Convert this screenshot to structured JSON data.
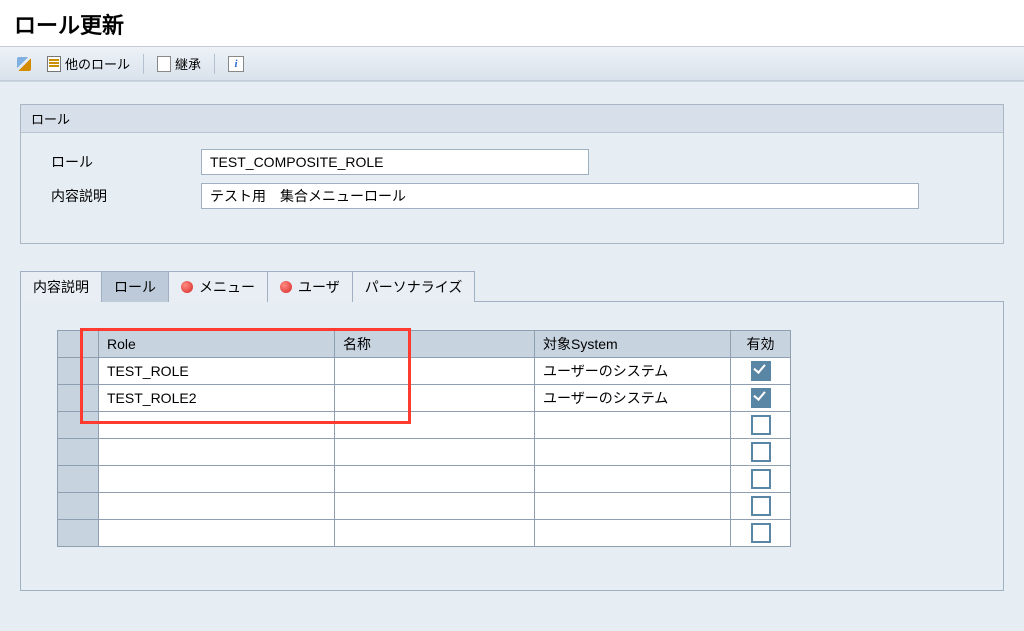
{
  "pageTitle": "ロール更新",
  "toolbar": {
    "otherRoles": "他のロール",
    "inherit": "継承"
  },
  "group": {
    "title": "ロール",
    "roleLabel": "ロール",
    "roleValue": "TEST_COMPOSITE_ROLE",
    "descLabel": "内容説明",
    "descValue": "テスト用　集合メニューロール"
  },
  "tabs": {
    "desc": "内容説明",
    "roles": "ロール",
    "menu": "メニュー",
    "user": "ユーザ",
    "personalize": "パーソナライズ"
  },
  "table": {
    "headers": {
      "role": "Role",
      "name": "名称",
      "system": "対象System",
      "effective": "有効"
    },
    "rows": [
      {
        "role": "TEST_ROLE",
        "name": "",
        "system": "ユーザーのシステム",
        "effective": true
      },
      {
        "role": "TEST_ROLE2",
        "name": "",
        "system": "ユーザーのシステム",
        "effective": true
      },
      {
        "role": "",
        "name": "",
        "system": "",
        "effective": false
      },
      {
        "role": "",
        "name": "",
        "system": "",
        "effective": false
      },
      {
        "role": "",
        "name": "",
        "system": "",
        "effective": false
      },
      {
        "role": "",
        "name": "",
        "system": "",
        "effective": false
      },
      {
        "role": "",
        "name": "",
        "system": "",
        "effective": false
      }
    ]
  }
}
